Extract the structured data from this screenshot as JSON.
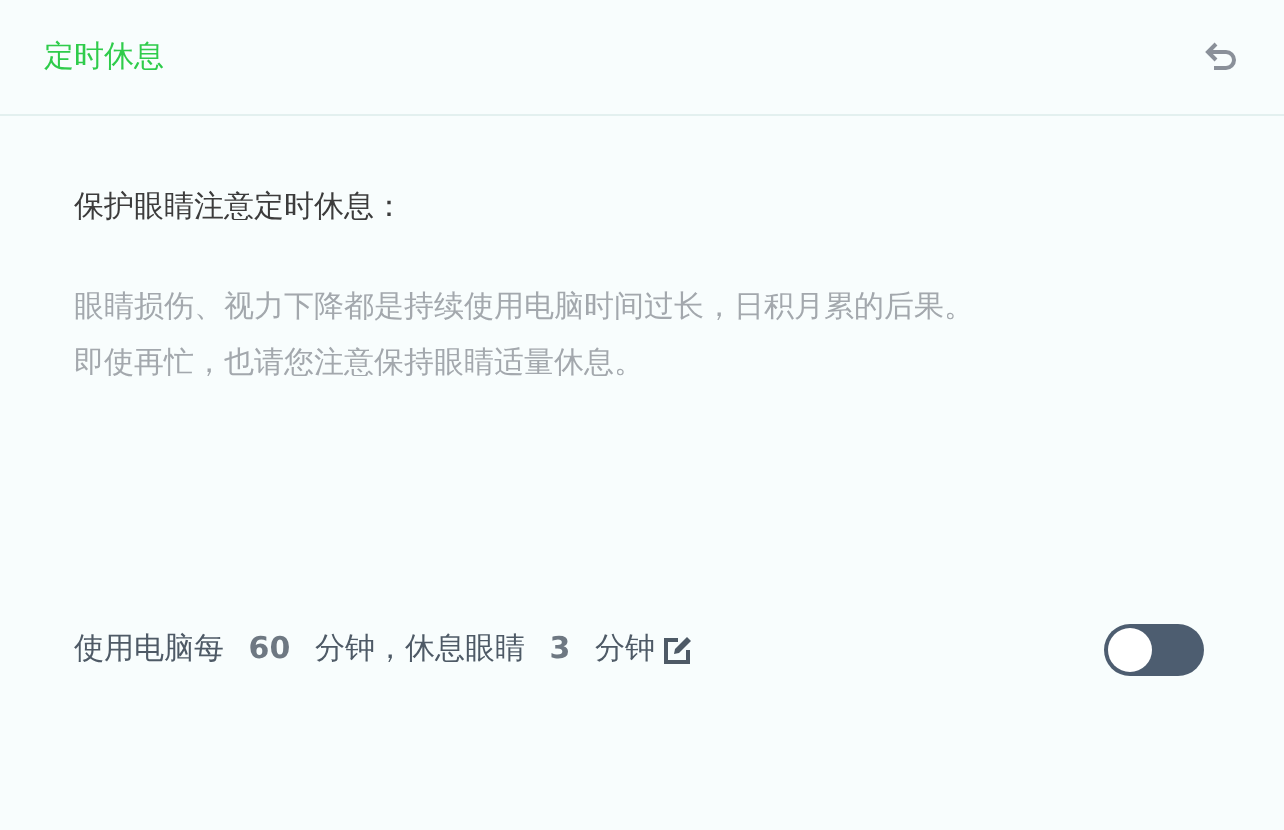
{
  "header": {
    "title": "定时休息"
  },
  "notice": {
    "heading": "保护眼睛注意定时休息：",
    "lines": [
      "眼睛损伤、视力下降都是持续使用电脑时间过长，日积月累的后果。",
      "即使再忙，也请您注意保持眼睛适量休息。"
    ]
  },
  "setting": {
    "text": "使用电脑每 **60** 分钟，休息眼睛 **3** 分钟",
    "on": false
  }
}
